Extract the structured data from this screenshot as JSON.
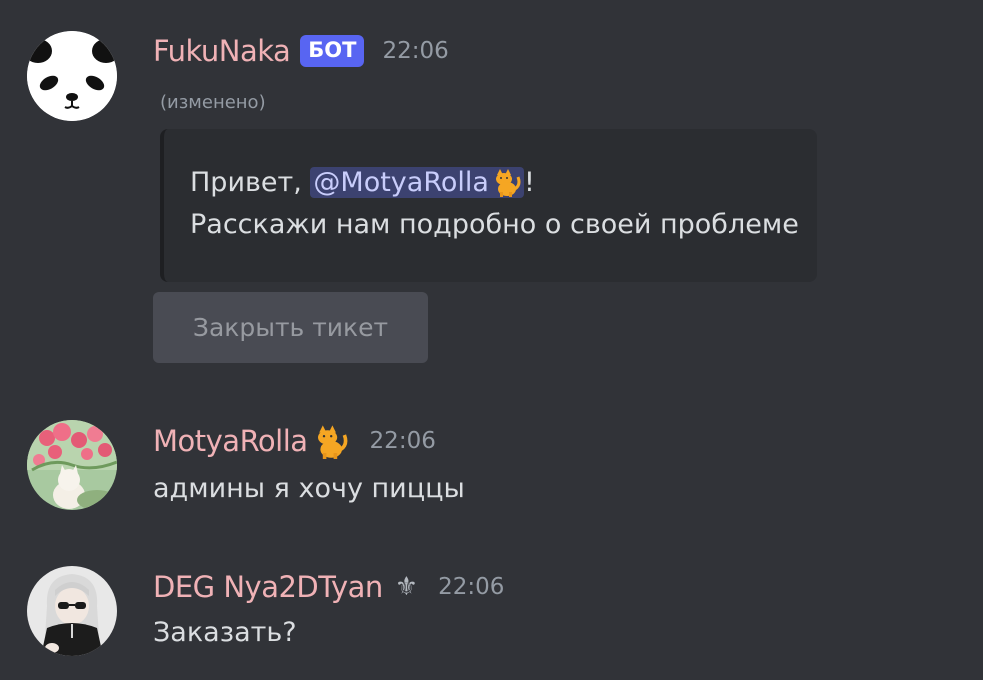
{
  "colors": {
    "background": "#313338",
    "username": "#f0b2b6",
    "timestamp": "#949ba4",
    "bot_badge": "#5865f2",
    "mention_bg": "#3c4270",
    "embed_bg": "#2b2d31",
    "button_bg": "#4e5058"
  },
  "messages": [
    {
      "username": "FukuNaka",
      "badge": "БОТ",
      "timestamp": "22:06",
      "edited": "(изменено)",
      "avatar_icon": "panda-face-icon",
      "embed": {
        "greeting": "Привет, ",
        "mention": "@MotyaRolla",
        "mention_icon": "cat-emoji-icon",
        "greeting_end": "!",
        "line2": "Расскажи нам подробно о своей проблеме"
      },
      "button_label": "Закрыть тикет"
    },
    {
      "username": "MotyaRolla",
      "username_icon": "cat-emoji-icon",
      "timestamp": "22:06",
      "avatar_icon": "cat-with-flowers-avatar",
      "text": "админы я хочу пиццы"
    },
    {
      "username": "DEG Nya2DTyan",
      "username_icon": "fleur-de-lis-icon",
      "username_symbol": "⚜",
      "timestamp": "22:06",
      "avatar_icon": "anime-girl-avatar",
      "text": "Заказать?"
    }
  ]
}
